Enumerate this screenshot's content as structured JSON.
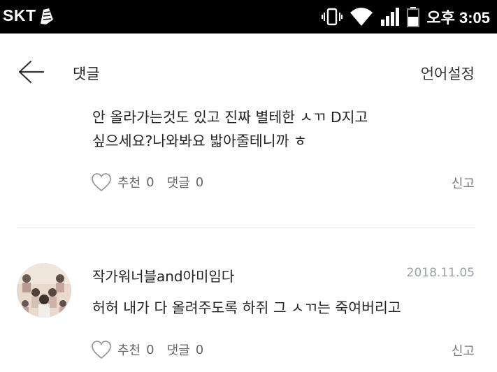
{
  "status_bar": {
    "carrier": "SKT",
    "time": "오후 3:05",
    "icons": [
      "app-notification-icon",
      "vibrate-icon",
      "wifi-icon",
      "signal-icon",
      "battery-icon"
    ]
  },
  "header": {
    "title": "댓글",
    "language_settings": "언어설정"
  },
  "comments": [
    {
      "text_line1": "안 올라가는것도 있고 진짜 별테한 ㅅㄲ D지고",
      "text_line2": "싶으세요?나와봐요 밟아줄테니까 ㅎ",
      "like_label": "추천",
      "like_count": "0",
      "reply_label": "댓글",
      "reply_count": "0",
      "report_label": "신고"
    },
    {
      "author": "작가워너블and아미임다",
      "date": "2018.11.05",
      "text_line1": "허허 내가 다 올려주도록 하쥐 그 ㅅㄲ는 죽여버리고",
      "like_label": "추천",
      "like_count": "0",
      "reply_label": "댓글",
      "reply_count": "0",
      "report_label": "신고"
    }
  ],
  "colors": {
    "status_bar_bg": "#000000",
    "divider": "#e3e3e3",
    "muted_text": "#666666",
    "date_text": "#9aa0a6"
  }
}
